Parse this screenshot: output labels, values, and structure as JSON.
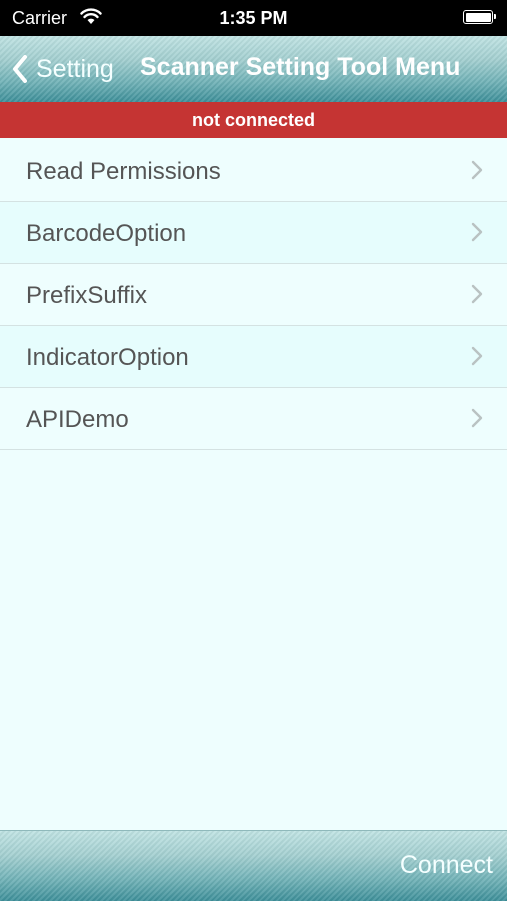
{
  "status_bar": {
    "carrier": "Carrier",
    "time": "1:35 PM",
    "wifi_icon": "wifi-icon",
    "battery_icon": "battery-full-icon"
  },
  "nav": {
    "back_label": "Setting",
    "back_icon": "chevron-left-icon",
    "title": "Scanner Setting Tool Menu"
  },
  "banner": {
    "text": "not connected",
    "color": "#c53433"
  },
  "menu": {
    "items": [
      {
        "label": "Read Permissions"
      },
      {
        "label": "BarcodeOption"
      },
      {
        "label": "PrefixSuffix"
      },
      {
        "label": "IndicatorOption"
      },
      {
        "label": "APIDemo"
      }
    ],
    "row_icon": "chevron-right-icon"
  },
  "toolbar": {
    "connect_label": "Connect"
  },
  "colors": {
    "background": "#eefefe",
    "bar_accent": "#6fb1b6",
    "text": "#555555"
  }
}
